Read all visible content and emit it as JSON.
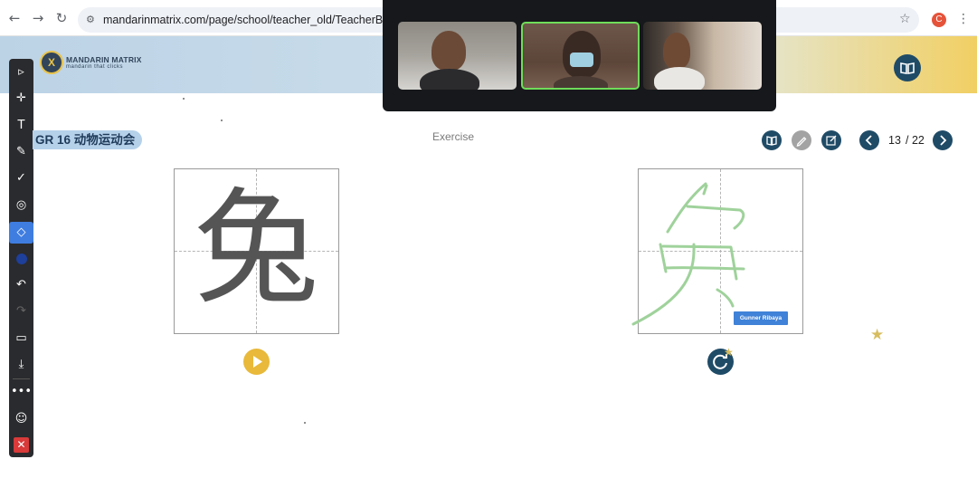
{
  "browser": {
    "url": "mandarinmatrix.com/page/school/teacher_old/TeacherBookRea",
    "profile_initial": "C"
  },
  "banner": {
    "logo_name": "MANDARIN MATRIX",
    "logo_tagline": "mandarin that clicks",
    "logo_mark": "X"
  },
  "lesson": {
    "tag": "GR 16 动物运动会",
    "title": "Exercise",
    "page_current": "13",
    "page_total": "/ 22"
  },
  "exercise": {
    "model_character": "兔",
    "student_name": "Gunner Ribaya"
  },
  "toolbar": {
    "tools": [
      "pointer",
      "move",
      "text",
      "pen",
      "check",
      "laser",
      "eraser",
      "color",
      "undo",
      "redo",
      "delete",
      "download",
      "more",
      "participants",
      "close"
    ],
    "active_tool": "eraser",
    "pen_color": "#1e3f9a"
  },
  "colors": {
    "brand_navy": "#1f4b67",
    "accent_gold": "#e8b93a",
    "stroke_green": "#9fd29b",
    "active_speaker": "#6fdc5a"
  }
}
